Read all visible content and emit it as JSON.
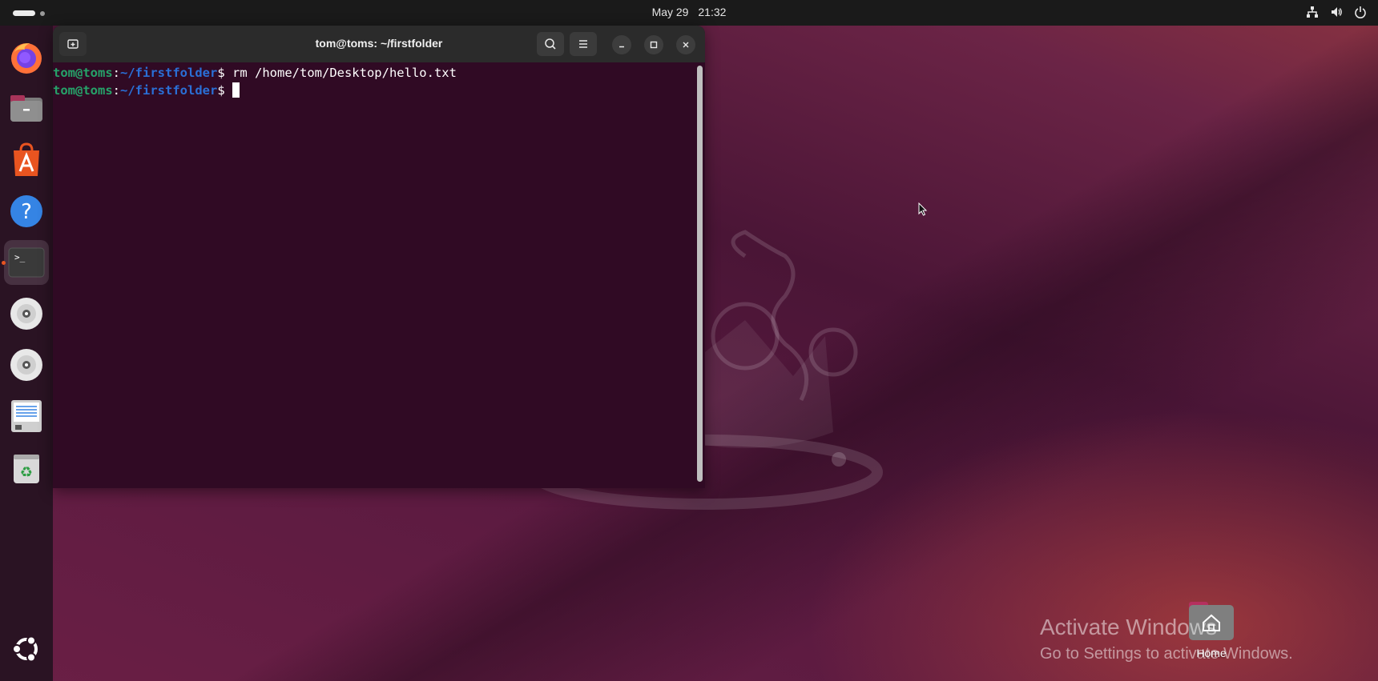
{
  "topbar": {
    "date": "May 29",
    "time": "21:32",
    "tray_icons": [
      "network-icon",
      "volume-icon",
      "power-icon"
    ]
  },
  "dock": {
    "items": [
      {
        "name": "firefox",
        "icon": "firefox-icon"
      },
      {
        "name": "files",
        "icon": "files-icon"
      },
      {
        "name": "app-center",
        "icon": "app-center-icon"
      },
      {
        "name": "help",
        "icon": "help-icon"
      },
      {
        "name": "terminal",
        "icon": "terminal-icon",
        "active": true
      },
      {
        "name": "disc-1",
        "icon": "disc-icon"
      },
      {
        "name": "disc-2",
        "icon": "disc-icon"
      },
      {
        "name": "text-editor",
        "icon": "document-icon"
      },
      {
        "name": "trash",
        "icon": "trash-icon"
      },
      {
        "name": "show-apps",
        "icon": "ubuntu-logo-icon"
      }
    ],
    "terminal_glyph": ">_"
  },
  "terminal": {
    "title": "tom@toms: ~/firstfolder",
    "lines": [
      {
        "user": "tom@toms",
        "sep": ":",
        "path": "~/firstfolder",
        "prompt": "$ ",
        "command": "rm /home/tom/Desktop/hello.txt"
      },
      {
        "user": "tom@toms",
        "sep": ":",
        "path": "~/firstfolder",
        "prompt": "$ ",
        "command": ""
      }
    ],
    "colors": {
      "background": "#300a24",
      "user": "#26a269",
      "path": "#2a6fd6"
    }
  },
  "desktop": {
    "home_label": "Home"
  },
  "watermark": {
    "line1": "Activate Windows",
    "line2": "Go to Settings to activate Windows."
  }
}
